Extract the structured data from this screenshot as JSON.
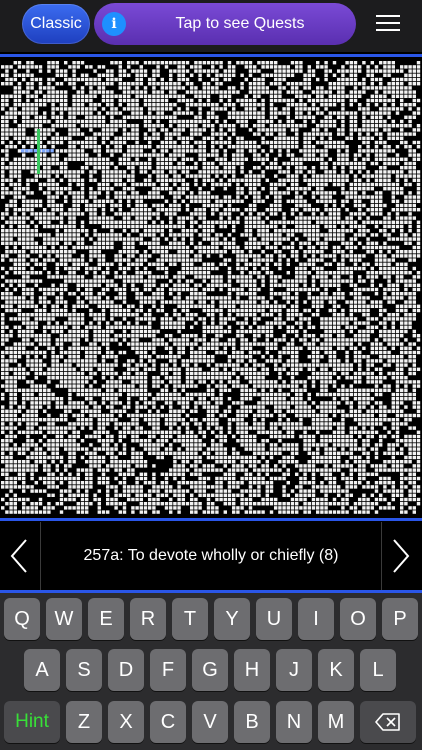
{
  "header": {
    "mode_label": "Classic",
    "info_glyph": "i",
    "quest_label": "Tap to see Quests",
    "menu_icon": "hamburger-menu-icon"
  },
  "colors": {
    "accent_blue": "#2a56e8",
    "mode_button": "#2f5be0",
    "quest_pill": "#6a3dc4",
    "info_icon": "#1e90ff",
    "hint_green": "#38e038",
    "key_bg": "#6d6d70",
    "keyboard_bg": "#2c2c2e"
  },
  "clue": {
    "text": "257a: To devote wholly or chiefly (8)",
    "prev_icon": "chevron-left-icon",
    "next_icon": "chevron-right-icon"
  },
  "keyboard": {
    "rows": [
      [
        "Q",
        "W",
        "E",
        "R",
        "T",
        "Y",
        "U",
        "I",
        "O",
        "P"
      ],
      [
        "A",
        "S",
        "D",
        "F",
        "G",
        "H",
        "J",
        "K",
        "L"
      ],
      [
        "Z",
        "X",
        "C",
        "V",
        "B",
        "N",
        "M"
      ]
    ],
    "hint_label": "Hint",
    "backspace_icon": "backspace-icon"
  }
}
